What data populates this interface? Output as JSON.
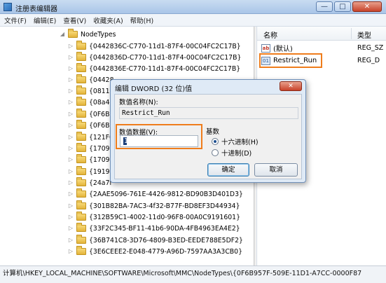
{
  "window": {
    "title": "注册表编辑器",
    "buttons": {
      "minimize": "—",
      "maximize": "□",
      "close": "✕"
    }
  },
  "menu": [
    "文件(F)",
    "编辑(E)",
    "查看(V)",
    "收藏夹(A)",
    "帮助(H)"
  ],
  "tree": {
    "parent": "NodeTypes",
    "items": [
      "{0442836C-C770-11d1-87F4-00C04FC2C17B}",
      "{0442836D-C770-11d1-87F4-00C04FC2C17B}",
      "{0442836E-C770-11d1-87F4-00C04FC2C17B}",
      "{04428",
      "{08114",
      "{08a4e",
      "{0F6B9",
      "{0F6B9",
      "{121F0",
      "{17096",
      "{17096",
      "{19195",
      "{24a7f",
      "{2AAE5096-761E-4426-9812-BD90B3D401D3}",
      "{301B82BA-7AC3-4f32-B77F-BD8EF3D44934}",
      "{312B59C1-4002-11d0-96F8-00A0C9191601}",
      "{33F2C345-BF11-41b6-90DA-4FB4963EA4E2}",
      "{36B741C8-3D76-4809-B3ED-EEDE788E5DF2}",
      "{3E6CEEE2-E048-4779-A96D-7597AA3A3CB0}"
    ]
  },
  "list": {
    "headers": {
      "name": "名称",
      "type": "类型"
    },
    "rows": [
      {
        "icon": "string-value-icon",
        "name": "(默认)",
        "type": "REG_SZ"
      },
      {
        "icon": "binary-value-icon",
        "name": "Restrict_Run",
        "type": "REG_D"
      }
    ]
  },
  "dialog": {
    "title": "编辑 DWORD (32 位)值",
    "close": "✕",
    "value_name_label": "数值名称(N):",
    "value_name": "Restrict_Run",
    "value_data_label": "数值数据(V):",
    "value_data": "1",
    "base_label": "基数",
    "hex_label": "十六进制(H)",
    "dec_label": "十进制(D)",
    "selected_base": "hex",
    "ok": "确定",
    "cancel": "取消"
  },
  "status": "计算机\\HKEY_LOCAL_MACHINE\\SOFTWARE\\Microsoft\\MMC\\NodeTypes\\{0F6B957F-509E-11D1-A7CC-0000F87",
  "colors": {
    "highlight": "#ef7d1c",
    "title_bar": "#a9c5e8",
    "dialog_bg": "#dfeaf6"
  }
}
